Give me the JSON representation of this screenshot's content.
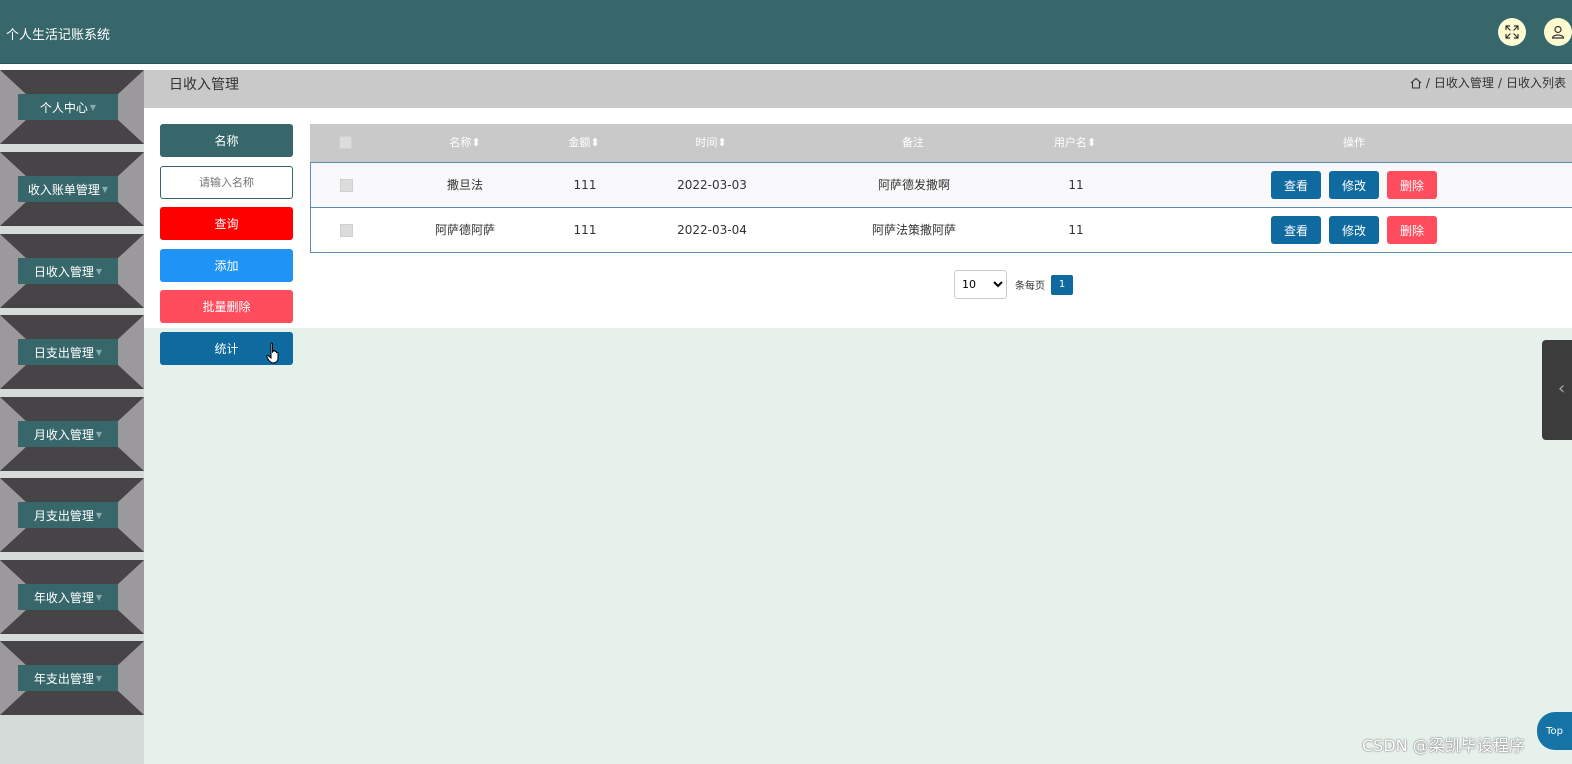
{
  "app": {
    "title": "个人生活记账系统"
  },
  "header_icons": [
    "fullscreen-icon",
    "user-icon"
  ],
  "sidebar": {
    "items": [
      {
        "label": "个人中心"
      },
      {
        "label": "收入账单管理"
      },
      {
        "label": "日收入管理"
      },
      {
        "label": "日支出管理"
      },
      {
        "label": "月收入管理"
      },
      {
        "label": "月支出管理"
      },
      {
        "label": "年收入管理"
      },
      {
        "label": "年支出管理"
      }
    ]
  },
  "page": {
    "title": "日收入管理",
    "breadcrumb": [
      "日收入管理",
      "日收入列表"
    ],
    "breadcrumb_sep": "/"
  },
  "search": {
    "label": "名称",
    "placeholder": "请输入名称",
    "query_button": "查询",
    "add_button": "添加",
    "batch_delete_button": "批量删除",
    "stats_button": "统计"
  },
  "table": {
    "columns": [
      "名称",
      "金额",
      "时间",
      "备注",
      "用户名",
      "操作"
    ],
    "sort_mark": "⬍",
    "rows": [
      {
        "name": "撒旦法",
        "amount": "111",
        "time": "2022-03-03",
        "note": "阿萨德发撒啊",
        "user": "11"
      },
      {
        "name": "阿萨德阿萨",
        "amount": "111",
        "time": "2022-03-04",
        "note": "阿萨法策撒阿萨",
        "user": "11"
      }
    ],
    "actions": {
      "view": "查看",
      "edit": "修改",
      "delete": "删除"
    }
  },
  "pagination": {
    "page_size": "10",
    "per_page_label": "条每页",
    "current_page": "1"
  },
  "top_button": "Top",
  "watermark": "CSDN @梁凯毕设程序",
  "colors": {
    "header": "#37676a",
    "query": "#ff0000",
    "add": "#2094f6",
    "batch_delete": "#ff4d5e",
    "stats": "#0f6aa0",
    "view": "#0f6aa0",
    "edit": "#0f6aa0",
    "delete": "#ff4d5e"
  }
}
